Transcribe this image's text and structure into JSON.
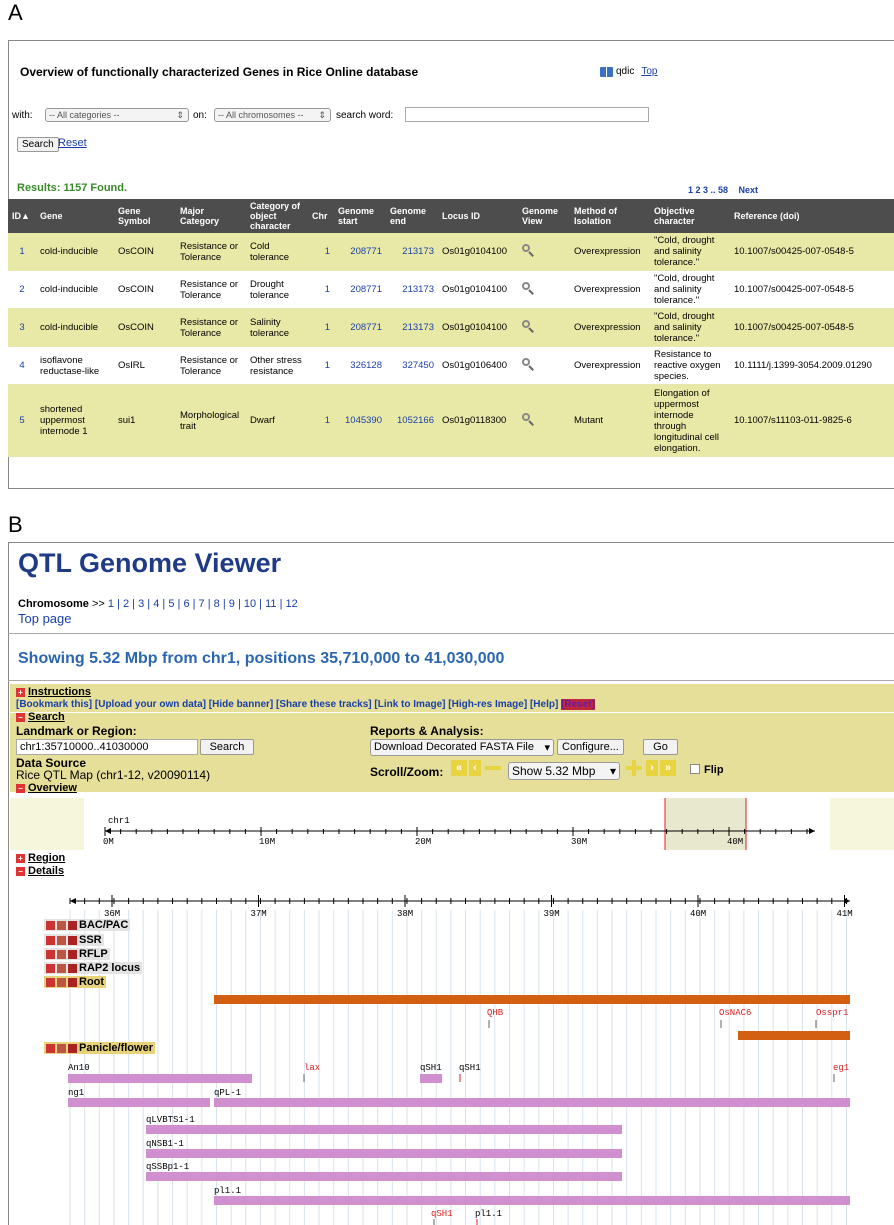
{
  "panel_a": {
    "letter": "A",
    "title": "Overview of functionally characterized Genes in Rice Online database",
    "qdic_label": "qdic",
    "top_label": "Top",
    "with_label": "with:",
    "category_select": "-- All categories --",
    "on_label": "on:",
    "chromosome_select": "-- All chromosomes --",
    "search_word_label": "search word:",
    "search_button": "Search",
    "reset_link": "Reset",
    "results_text": "Results: 1157 Found.",
    "pagination": "1 2 3 .. 58",
    "next_link": "Next",
    "columns": [
      "ID▲",
      "Gene",
      "Gene Symbol",
      "Major Category",
      "Category of object character",
      "Chr",
      "Genome start",
      "Genome end",
      "Locus ID",
      "Genome View",
      "Method of Isolation",
      "Objective character",
      "Reference (doi)"
    ],
    "rows": [
      {
        "id": "1",
        "gene": "cold-inducible",
        "symbol": "OsCOIN",
        "major": "Resistance or Tolerance",
        "category": "Cold tolerance",
        "chr": "1",
        "start": "208771",
        "end": "213173",
        "locus": "Os01g0104100",
        "method": "Overexpression",
        "objective": "\"Cold, drought and salinity tolerance.\"",
        "ref": "10.1007/s00425-007-0548-5"
      },
      {
        "id": "2",
        "gene": "cold-inducible",
        "symbol": "OsCOIN",
        "major": "Resistance or Tolerance",
        "category": "Drought tolerance",
        "chr": "1",
        "start": "208771",
        "end": "213173",
        "locus": "Os01g0104100",
        "method": "Overexpression",
        "objective": "\"Cold, drought and salinity tolerance.\"",
        "ref": "10.1007/s00425-007-0548-5"
      },
      {
        "id": "3",
        "gene": "cold-inducible",
        "symbol": "OsCOIN",
        "major": "Resistance or Tolerance",
        "category": "Salinity tolerance",
        "chr": "1",
        "start": "208771",
        "end": "213173",
        "locus": "Os01g0104100",
        "method": "Overexpression",
        "objective": "\"Cold, drought and salinity tolerance.\"",
        "ref": "10.1007/s00425-007-0548-5"
      },
      {
        "id": "4",
        "gene": "isoflavone reductase-like",
        "symbol": "OsIRL",
        "major": "Resistance or Tolerance",
        "category": "Other stress resistance",
        "chr": "1",
        "start": "326128",
        "end": "327450",
        "locus": "Os01g0106400",
        "method": "Overexpression",
        "objective": "Resistance to reactive oxygen species.",
        "ref": "10.1111/j.1399-3054.2009.01290"
      },
      {
        "id": "5",
        "gene": "shortened uppermost internode 1",
        "symbol": "sui1",
        "major": "Morphological trait",
        "category": "Dwarf",
        "chr": "1",
        "start": "1045390",
        "end": "1052166",
        "locus": "Os01g0118300",
        "method": "Mutant",
        "objective": "Elongation of uppermost internode through longitudinal cell elongation.",
        "ref": "10.1007/s11103-011-9825-6"
      }
    ]
  },
  "panel_b": {
    "letter": "B",
    "title": "QTL Genome Viewer",
    "chromosome_label": "Chromosome",
    "chromosome_sep": ">>",
    "chromosomes": [
      "1",
      "2",
      "3",
      "4",
      "5",
      "6",
      "7",
      "8",
      "9",
      "10",
      "11",
      "12"
    ],
    "top_page": "Top page",
    "showing": "Showing 5.32 Mbp from chr1, positions 35,710,000 to 41,030,000",
    "instructions": "Instructions",
    "links_bar": "[Bookmark this] [Upload your own data] [Hide banner] [Share these tracks] [Link to Image] [High-res Image] [Help]",
    "reset_tag": "[Reset]",
    "search_section": "Search",
    "landmark_label": "Landmark or Region:",
    "landmark_value": "chr1:35710000..41030000",
    "search_button": "Search",
    "data_source_label": "Data Source",
    "data_source_value": "Rice QTL Map (chr1-12, v20090114)",
    "reports_label": "Reports & Analysis:",
    "reports_select": "Download Decorated FASTA File",
    "configure_button": "Configure...",
    "go_button": "Go",
    "scroll_label": "Scroll/Zoom:",
    "zoom_select": "Show 5.32 Mbp",
    "flip_label": "Flip",
    "overview_section": "Overview",
    "overview_chr": "chr1",
    "overview_ticks": [
      "0M",
      "10M",
      "20M",
      "30M",
      "40M"
    ],
    "region_section": "Region",
    "details_section": "Details",
    "detail_ticks": [
      "36M",
      "37M",
      "38M",
      "39M",
      "40M",
      "41M"
    ],
    "tracks": [
      "BAC/PAC",
      "SSR",
      "RFLP",
      "RAP2 locus",
      "Root",
      "Panicle/flower"
    ],
    "root_labels": [
      "QHB",
      "OsNAC6",
      "Osspr1"
    ],
    "panicle_labels": [
      "An10",
      "lax",
      "qSH1",
      "qSH1",
      "eg1",
      "ng1",
      "qPL-1",
      "qLVBTS1-1",
      "qNSB1-1",
      "qSSBp1-1",
      "pl1.1",
      "qSH1",
      "pl1.1"
    ],
    "colors": {
      "root_bar": "#d35f12",
      "panicle_bar": "#d08fcf",
      "title_blue": "#1f3b87",
      "link_blue": "#1a3fa8",
      "yellow": "#e6df99"
    }
  }
}
